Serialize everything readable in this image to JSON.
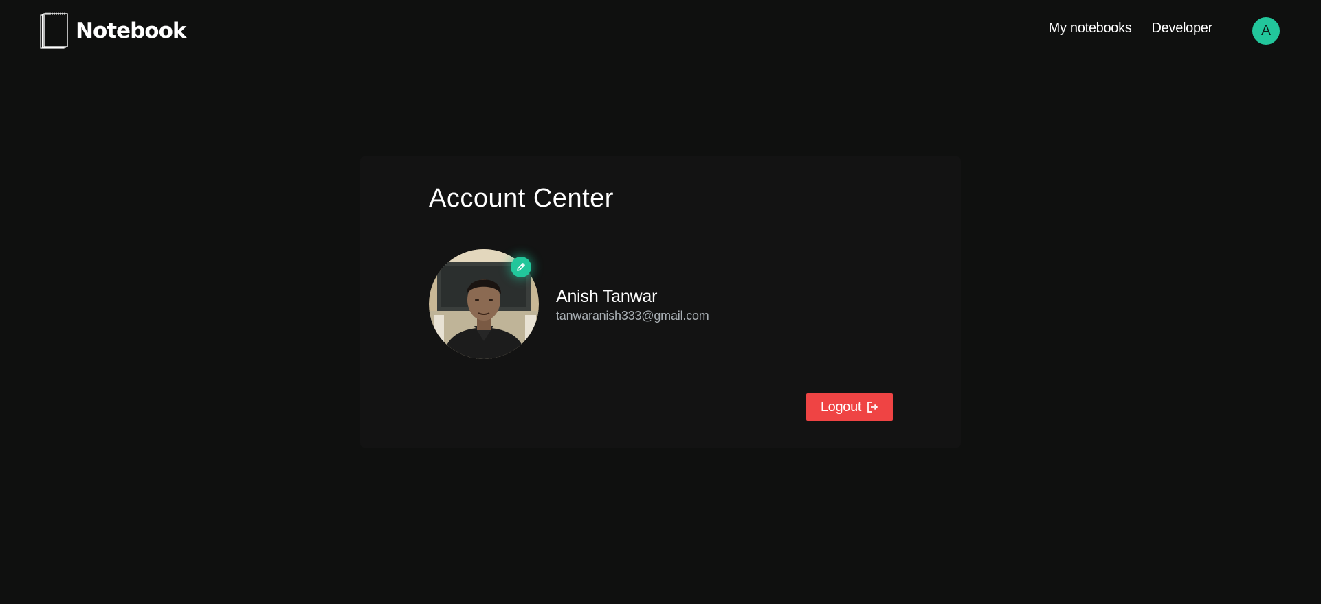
{
  "header": {
    "brand": "Notebook",
    "nav": [
      {
        "label": "My notebooks"
      },
      {
        "label": "Developer"
      }
    ],
    "avatar_initial": "A",
    "accent_color": "#22c69b"
  },
  "account": {
    "title": "Account Center",
    "name": "Anish Tanwar",
    "email": "tanwaranish333@gmail.com",
    "photo_alt": "profile-photo",
    "edit_icon": "pencil-icon",
    "logout_label": "Logout",
    "logout_icon": "logout-icon",
    "logout_color": "#ef4444"
  }
}
